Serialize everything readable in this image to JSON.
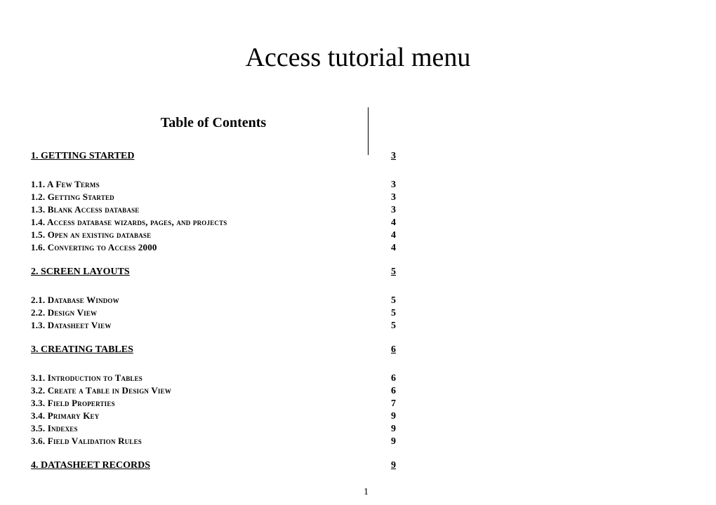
{
  "document": {
    "title": "Access tutorial menu",
    "tocHeading": "Table of Contents",
    "pageNumber": "1"
  },
  "sections": [
    {
      "title": "1. GETTING STARTED",
      "page": "3",
      "subs": [
        {
          "title": "1.1. A Few Terms",
          "page": "3"
        },
        {
          "title": "1.2. Getting Started",
          "page": "3"
        },
        {
          "title": "1.3. Blank Access database",
          "page": "3"
        },
        {
          "title": "1.4. Access database wizards, pages, and projects",
          "page": "4"
        },
        {
          "title": "1.5. Open an existing database",
          "page": "4"
        },
        {
          "title": "1.6. Converting to Access 2000",
          "page": "4"
        }
      ]
    },
    {
      "title": "2. SCREEN LAYOUTS",
      "page": "5",
      "subs": [
        {
          "title": "2.1. Database Window",
          "page": "5"
        },
        {
          "title": "2.2. Design View",
          "page": "5"
        },
        {
          "title": "1.3. Datasheet View",
          "page": "5"
        }
      ]
    },
    {
      "title": "3. CREATING TABLES",
      "page": "6",
      "subs": [
        {
          "title": "3.1. Introduction to Tables",
          "page": "6"
        },
        {
          "title": "3.2. Create a Table in Design View",
          "page": "6"
        },
        {
          "title": "3.3. Field Properties",
          "page": "7"
        },
        {
          "title": "3.4. Primary Key",
          "page": "9"
        },
        {
          "title": "3.5. Indexes",
          "page": "9"
        },
        {
          "title": "3.6. Field Validation Rules",
          "page": "9"
        }
      ]
    },
    {
      "title": "4. DATASHEET RECORDS",
      "page": "9",
      "subs": []
    }
  ]
}
